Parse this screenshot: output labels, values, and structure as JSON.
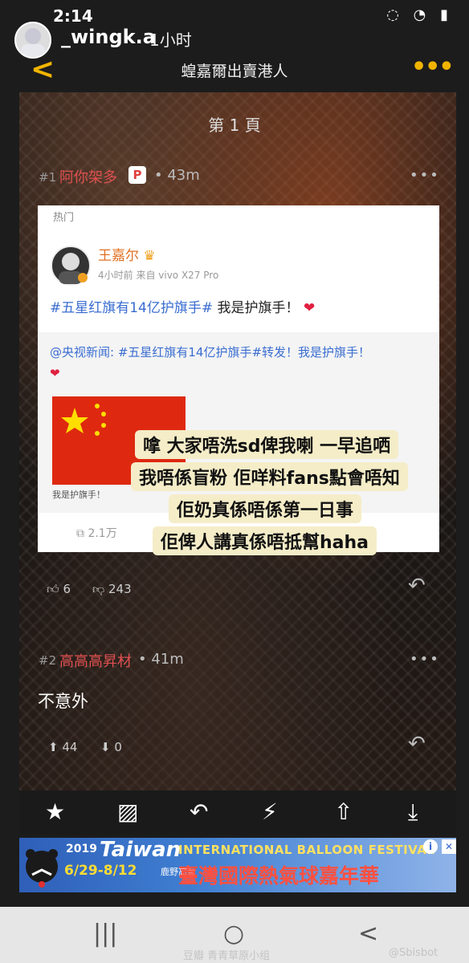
{
  "status": {
    "time": "2:14",
    "icons": "◌ ◔ ▮"
  },
  "story": {
    "username": "_wingk.a",
    "time": "1小时"
  },
  "nav": {
    "back": "<",
    "title": "蝗嘉爾出賣港人",
    "more": "•••"
  },
  "page": {
    "label": "第 1 頁"
  },
  "post1": {
    "floor": "#1",
    "user": "阿你架多",
    "badge": "P",
    "time": "• 43m",
    "more": "•••",
    "likes": "6",
    "dislikes": "243"
  },
  "weibo": {
    "hot": "热门",
    "name": "王嘉尔",
    "meta": "4小时前 来自 vivo X27 Pro",
    "hashtag": "#五星红旗有14亿护旗手#",
    "text": " 我是护旗手！",
    "heart": "❤",
    "repost_text": "@央视新闻: #五星红旗有14亿护旗手#转发！我是护旗手！",
    "repost_heart": "❤",
    "flag_caption": "我是护旗手！",
    "share_count": "2.1万"
  },
  "caption": {
    "lines": [
      "嗱 大家唔洗sd俾我喇 一早追哂",
      "我唔係盲粉 佢咩料fans點會唔知",
      "佢奶真係唔係第一日事",
      "佢俾人講真係唔抵幫haha"
    ]
  },
  "post2": {
    "floor": "#2",
    "user": "高高高昇材",
    "time": "• 41m",
    "more": "•••",
    "text": "不意外",
    "likes": "44",
    "dislikes": "0"
  },
  "toolbar": {
    "icons": [
      "star-icon",
      "image-icon",
      "reply-icon",
      "lightning-icon",
      "share-icon",
      "download-icon"
    ],
    "glyphs": [
      "★",
      "▨",
      "↶",
      "⚡",
      "⇧",
      "⤓"
    ]
  },
  "ad": {
    "year": "2019",
    "taiwan": "Taiwan",
    "dates": "6/29-8/12",
    "place": "鹿野高台",
    "intl": "INTERNATIONAL BALLOON FESTIVAL",
    "cn": "臺灣國際熱氣球嘉年華",
    "info": "i",
    "close": "✕"
  },
  "sysnav": {
    "recents": "|||",
    "home": "○",
    "back": "<"
  },
  "watermark": {
    "left": "豆瓣 青青草原小组",
    "right": "@Sbisbot"
  }
}
